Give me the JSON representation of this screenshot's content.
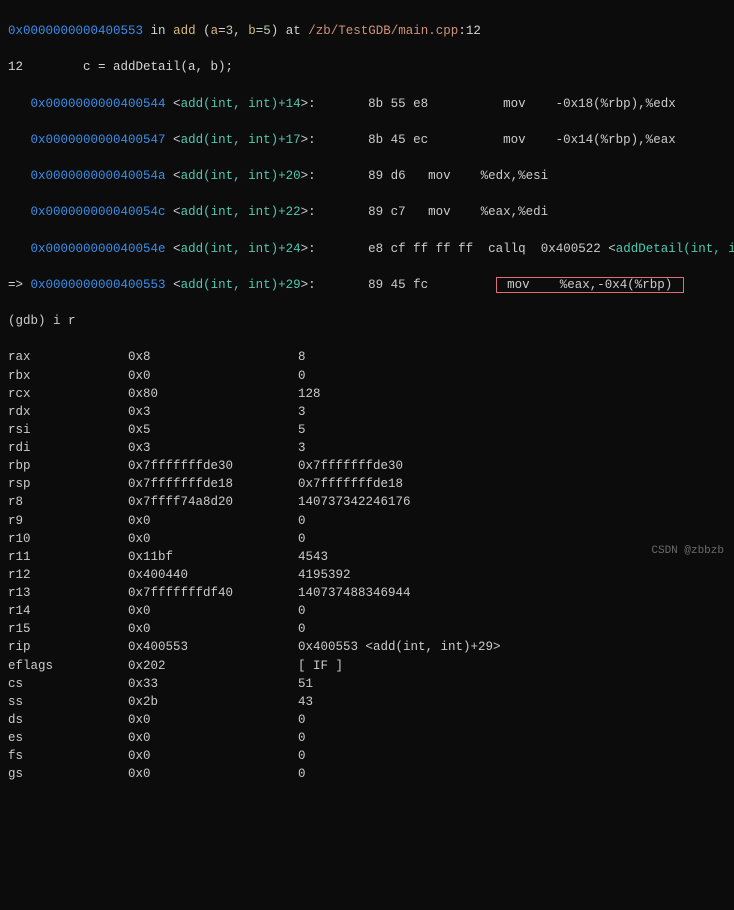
{
  "frame": {
    "addr": "0x0000000000400553",
    "in": "in",
    "func": "add",
    "a_name": "a",
    "a_val": "3",
    "b_name": "b",
    "b_val": "5",
    "at": "at",
    "file": "/zb/TestGDB/main.cpp",
    "line": "12"
  },
  "source": {
    "lineno": "12",
    "code": "c = addDetail(a, b);"
  },
  "curArrow": "=>",
  "dis": [
    {
      "addr": "0x0000000000400544",
      "sym": "add(int, int)+14",
      "bytes": "8b 55 e8",
      "mn": "mov",
      "ops": "-0x18(%rbp),%edx"
    },
    {
      "addr": "0x0000000000400547",
      "sym": "add(int, int)+17",
      "bytes": "8b 45 ec",
      "mn": "mov",
      "ops": "-0x14(%rbp),%eax"
    },
    {
      "addr": "0x000000000040054a",
      "sym": "add(int, int)+20",
      "bytes": "89 d6",
      "mn": "mov",
      "ops": "%edx,%esi"
    },
    {
      "addr": "0x000000000040054c",
      "sym": "add(int, int)+22",
      "bytes": "89 c7",
      "mn": "mov",
      "ops": "%eax,%edi"
    },
    {
      "addr": "0x000000000040054e",
      "sym": "add(int, int)+24",
      "bytes": "e8 cf ff ff ff",
      "mn": "callq",
      "ops": "0x400522",
      "target": "addDetail(int, int)"
    },
    {
      "addr": "0x0000000000400553",
      "sym": "add(int, int)+29",
      "bytes": "89 45 fc",
      "mn": "mov",
      "ops": "%eax,-0x4(%rbp)"
    }
  ],
  "prompt": {
    "text": "(gdb) i r"
  },
  "regs": [
    {
      "name": "rax",
      "hex": "0x8",
      "dec": "8"
    },
    {
      "name": "rbx",
      "hex": "0x0",
      "dec": "0"
    },
    {
      "name": "rcx",
      "hex": "0x80",
      "dec": "128"
    },
    {
      "name": "rdx",
      "hex": "0x3",
      "dec": "3"
    },
    {
      "name": "rsi",
      "hex": "0x5",
      "dec": "5"
    },
    {
      "name": "rdi",
      "hex": "0x3",
      "dec": "3"
    },
    {
      "name": "rbp",
      "hex": "0x7fffffffde30",
      "dec": "0x7fffffffde30"
    },
    {
      "name": "rsp",
      "hex": "0x7fffffffde18",
      "dec": "0x7fffffffde18"
    },
    {
      "name": "r8",
      "hex": "0x7ffff74a8d20",
      "dec": "140737342246176"
    },
    {
      "name": "r9",
      "hex": "0x0",
      "dec": "0"
    },
    {
      "name": "r10",
      "hex": "0x0",
      "dec": "0"
    },
    {
      "name": "r11",
      "hex": "0x11bf",
      "dec": "4543"
    },
    {
      "name": "r12",
      "hex": "0x400440",
      "dec": "4195392"
    },
    {
      "name": "r13",
      "hex": "0x7fffffffdf40",
      "dec": "140737488346944"
    },
    {
      "name": "r14",
      "hex": "0x0",
      "dec": "0"
    },
    {
      "name": "r15",
      "hex": "0x0",
      "dec": "0"
    },
    {
      "name": "rip",
      "hex": "0x400553",
      "dec": "0x400553 <add(int, int)+29>"
    },
    {
      "name": "eflags",
      "hex": "0x202",
      "dec": "[ IF ]"
    },
    {
      "name": "cs",
      "hex": "0x33",
      "dec": "51"
    },
    {
      "name": "ss",
      "hex": "0x2b",
      "dec": "43"
    },
    {
      "name": "ds",
      "hex": "0x0",
      "dec": "0"
    },
    {
      "name": "es",
      "hex": "0x0",
      "dec": "0"
    },
    {
      "name": "fs",
      "hex": "0x0",
      "dec": "0"
    },
    {
      "name": "gs",
      "hex": "0x0",
      "dec": "0"
    }
  ],
  "watermark": "CSDN @zbbzb"
}
